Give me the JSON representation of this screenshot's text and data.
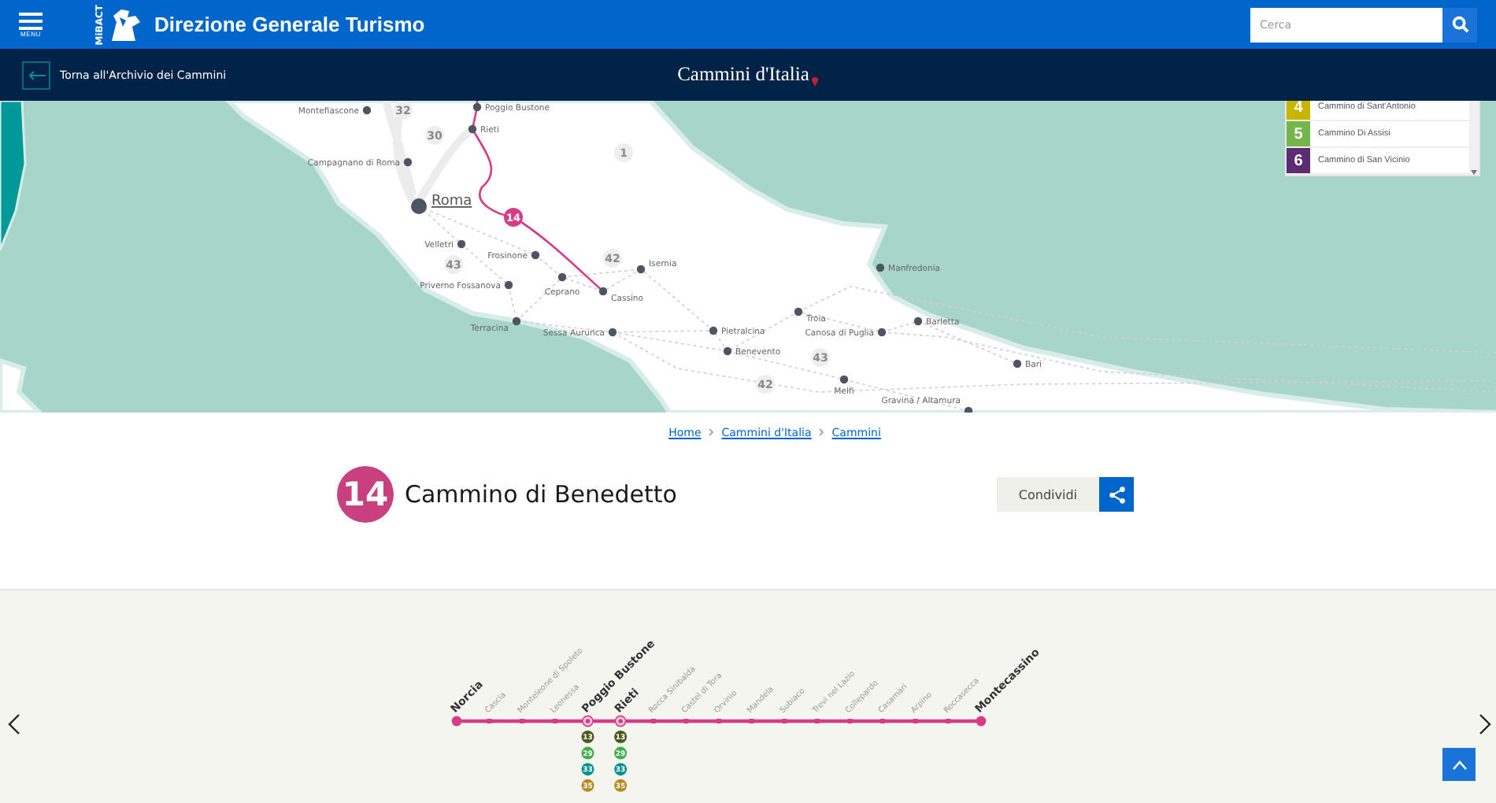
{
  "header": {
    "menu_label": "MENU",
    "logo_text": "MiBACT",
    "title": "Direzione Generale Turismo",
    "search": {
      "placeholder": "Cerca"
    }
  },
  "nav": {
    "back_label": "Torna all'Archivio dei Cammini",
    "logo_text": "Cammini d'Italia"
  },
  "map": {
    "towns": [
      {
        "name": "Montefiascone",
        "kind": "town"
      },
      {
        "name": "Poggio Bustone",
        "kind": "town"
      },
      {
        "name": "Rieti",
        "kind": "town"
      },
      {
        "name": "Campagnano di Roma",
        "kind": "town"
      },
      {
        "name": "Roma",
        "kind": "city"
      },
      {
        "name": "Velletri",
        "kind": "town"
      },
      {
        "name": "Frosinone",
        "kind": "town"
      },
      {
        "name": "Isernia",
        "kind": "town"
      },
      {
        "name": "Ceprano",
        "kind": "town"
      },
      {
        "name": "Priverno Fossanova",
        "kind": "town"
      },
      {
        "name": "Cassino",
        "kind": "town"
      },
      {
        "name": "Terracina",
        "kind": "town"
      },
      {
        "name": "Sessa Aurunca",
        "kind": "town"
      },
      {
        "name": "Pietralcina",
        "kind": "town"
      },
      {
        "name": "Benevento",
        "kind": "town"
      },
      {
        "name": "Troia",
        "kind": "town"
      },
      {
        "name": "Canosa di Puglia",
        "kind": "town"
      },
      {
        "name": "Barletta",
        "kind": "town"
      },
      {
        "name": "Manfredonia",
        "kind": "town"
      },
      {
        "name": "Bari",
        "kind": "town"
      },
      {
        "name": "Melfi",
        "kind": "town"
      },
      {
        "name": "Gravina / Altamura",
        "kind": "town"
      }
    ],
    "route_badges": [
      "32",
      "30",
      "1",
      "43",
      "42",
      "43",
      "42"
    ],
    "route": {
      "number": "14",
      "color": "#d63c86"
    },
    "legend": [
      {
        "number": "4",
        "name": "Cammino di Sant'Antonio",
        "color": "#c9b400"
      },
      {
        "number": "5",
        "name": "Cammino Di Assisi",
        "color": "#74b54c"
      },
      {
        "number": "6",
        "name": "Cammino di San Vicinio",
        "color": "#5b2c6f"
      }
    ]
  },
  "breadcrumbs": [
    "Home",
    "Cammini d'Italia",
    "Cammini"
  ],
  "title": {
    "number": "14",
    "name": "Cammino di Benedetto",
    "color": "#c9407f"
  },
  "share_label": "Condividi",
  "timeline": {
    "stops": [
      {
        "name": "Norcia",
        "kind": "end"
      },
      {
        "name": "Cascia",
        "kind": "stop"
      },
      {
        "name": "Monteleone di Spoleto",
        "kind": "stop"
      },
      {
        "name": "Leonessa",
        "kind": "stop"
      },
      {
        "name": "Poggio Bustone",
        "kind": "junction",
        "badges": [
          {
            "number": "13",
            "color": "#4b5a1f"
          },
          {
            "number": "29",
            "color": "#3fae49"
          },
          {
            "number": "33",
            "color": "#00928f"
          },
          {
            "number": "35",
            "color": "#b58a1f"
          }
        ]
      },
      {
        "name": "Rieti",
        "kind": "junction",
        "badges": [
          {
            "number": "13",
            "color": "#4b5a1f"
          },
          {
            "number": "29",
            "color": "#3fae49"
          },
          {
            "number": "33",
            "color": "#00928f"
          },
          {
            "number": "35",
            "color": "#b58a1f"
          }
        ]
      },
      {
        "name": "Rocca Sinibalda",
        "kind": "stop"
      },
      {
        "name": "Castel di Tora",
        "kind": "stop"
      },
      {
        "name": "Orvinio",
        "kind": "stop"
      },
      {
        "name": "Mandela",
        "kind": "stop"
      },
      {
        "name": "Subiaco",
        "kind": "stop"
      },
      {
        "name": "Trevi nel Lazio",
        "kind": "stop"
      },
      {
        "name": "Collepardo",
        "kind": "stop"
      },
      {
        "name": "Casamari",
        "kind": "stop"
      },
      {
        "name": "Arpino",
        "kind": "stop"
      },
      {
        "name": "Roccasecca",
        "kind": "stop"
      },
      {
        "name": "Montecassino",
        "kind": "end"
      }
    ]
  }
}
